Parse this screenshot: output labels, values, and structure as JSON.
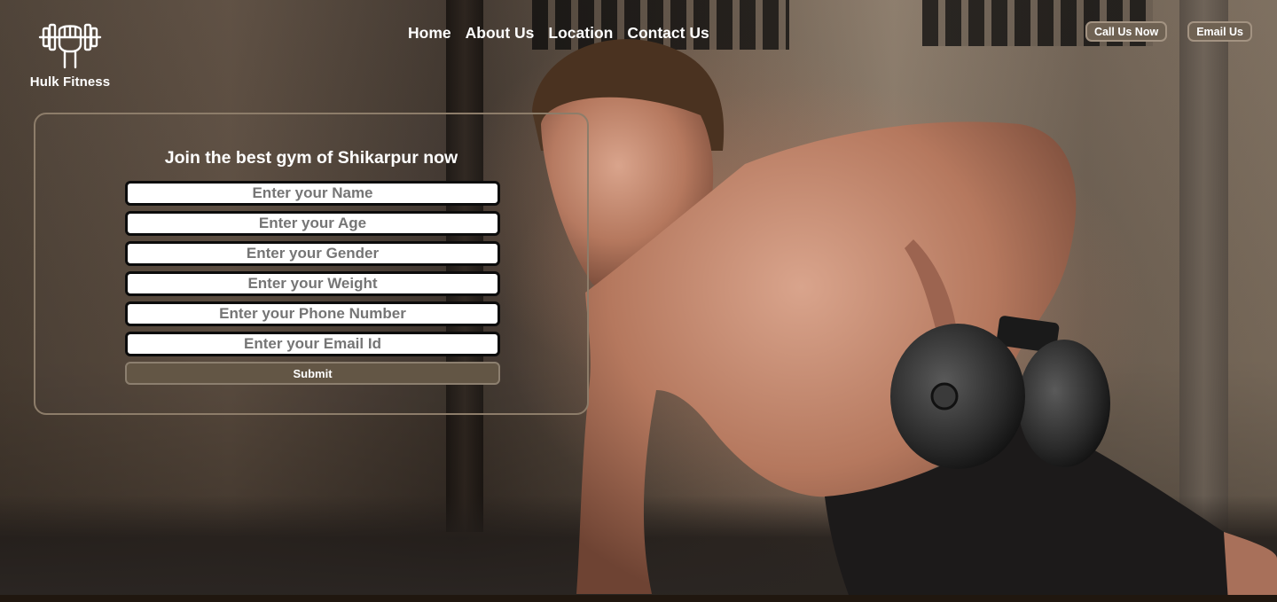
{
  "brand": {
    "name": "Hulk Fitness",
    "logo_icon": "dumbbell-fist-icon"
  },
  "nav": {
    "items": [
      {
        "label": "Home"
      },
      {
        "label": "About Us"
      },
      {
        "label": "Location"
      },
      {
        "label": "Contact Us"
      }
    ]
  },
  "header_actions": {
    "call_label": "Call Us Now",
    "email_label": "Email Us"
  },
  "form": {
    "title": "Join the best gym of Shikarpur now",
    "fields": {
      "name": {
        "placeholder": "Enter your Name",
        "value": ""
      },
      "age": {
        "placeholder": "Enter your Age",
        "value": ""
      },
      "gender": {
        "placeholder": "Enter your Gender",
        "value": ""
      },
      "weight": {
        "placeholder": "Enter your Weight",
        "value": ""
      },
      "phone": {
        "placeholder": "Enter your Phone Number",
        "value": ""
      },
      "email": {
        "placeholder": "Enter your Email Id",
        "value": ""
      }
    },
    "submit_label": "Submit"
  },
  "colors": {
    "accent_button": "#635645",
    "pill_button": "#6f6253",
    "card_border": "#8d7d6a",
    "text": "#ffffff"
  }
}
